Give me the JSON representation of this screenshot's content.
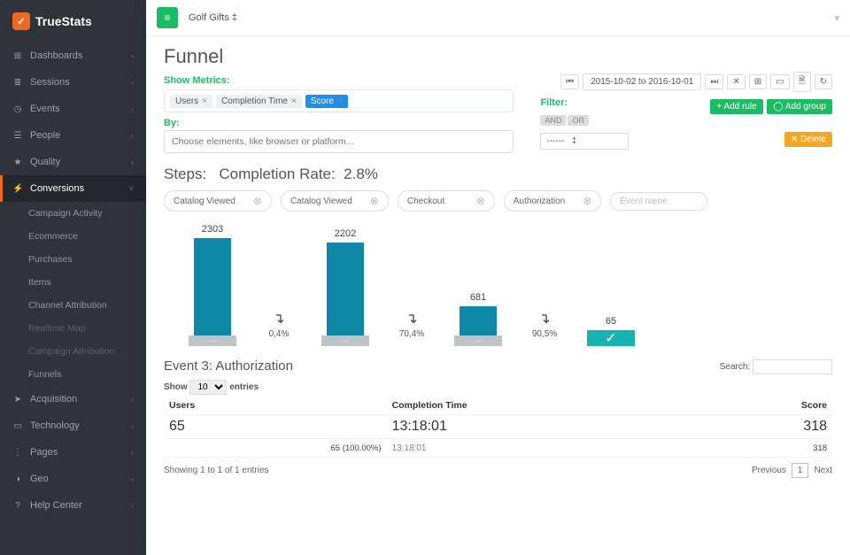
{
  "brand": "TrueStats",
  "topbar": {
    "project": "Golf Gifts ‡"
  },
  "sidebar": {
    "items": [
      {
        "icon": "⊞",
        "label": "Dashboards"
      },
      {
        "icon": "≣",
        "label": "Sessions"
      },
      {
        "icon": "◷",
        "label": "Events"
      },
      {
        "icon": "☰",
        "label": "People"
      },
      {
        "icon": "★",
        "label": "Quality"
      },
      {
        "icon": "⚡",
        "label": "Conversions",
        "active": true
      },
      {
        "icon": "➤",
        "label": "Acquisition"
      },
      {
        "icon": "▭",
        "label": "Technology"
      },
      {
        "icon": "⋮",
        "label": "Pages"
      },
      {
        "icon": "◑",
        "label": "Geo"
      },
      {
        "icon": "?",
        "label": "Help Center"
      }
    ],
    "sub": [
      "Campaign Activity",
      "Ecommerce",
      "Purchases",
      "Items",
      "Channel Attribution",
      "Realtime Map",
      "Campaign Attribution",
      "Funnels"
    ]
  },
  "page": {
    "title": "Funnel",
    "show_metrics_label": "Show Metrics:",
    "metrics": [
      {
        "label": "Users"
      },
      {
        "label": "Completion Time"
      },
      {
        "label": "Score",
        "selected": true
      }
    ],
    "by_label": "By:",
    "by_placeholder": "Choose elements, like browser or platform...",
    "daterange": "2015-10-02 to 2016-10-01",
    "filter_label": "Filter:",
    "filter_logic": [
      "AND",
      "OR"
    ],
    "filter_select": "------",
    "add_rule": "+ Add rule",
    "add_group": "◯ Add group",
    "delete": "✕ Delete",
    "steps_label": "Steps:",
    "completion_label": "Completion Rate:",
    "completion_value": "2.8%",
    "steps": [
      {
        "label": "Catalog Viewed",
        "value": 2303
      },
      {
        "label": "Catalog Viewed",
        "value": 2202
      },
      {
        "label": "Checkout",
        "value": 681
      },
      {
        "label": "Authorization",
        "value": 65
      }
    ],
    "step_placeholder": "Event name",
    "drops": [
      "0,4%",
      "70,4%",
      "90,5%"
    ]
  },
  "chart_data": {
    "type": "bar",
    "title": "Funnel Steps",
    "categories": [
      "Catalog Viewed",
      "Catalog Viewed",
      "Checkout",
      "Authorization"
    ],
    "values": [
      2303,
      2202,
      681,
      65
    ],
    "drop_off_rates": [
      0.4,
      70.4,
      90.5
    ],
    "ylim": [
      0,
      2303
    ]
  },
  "event": {
    "title": "Event 3: Authorization",
    "search_label": "Search:",
    "show_label": "Show",
    "entries_label": "entries",
    "page_size": "10",
    "columns": [
      "Users",
      "Completion Time",
      "Score"
    ],
    "row": {
      "users_big": "65",
      "users_meta": "65  (100.00%)",
      "ct_big": "13:18:01",
      "ct_small": "13:18:01",
      "score_big": "318",
      "score_small": "318"
    },
    "footer_info": "Showing 1 to 1 of 1 entries",
    "prev": "Previous",
    "next": "Next",
    "current_page": "1"
  }
}
